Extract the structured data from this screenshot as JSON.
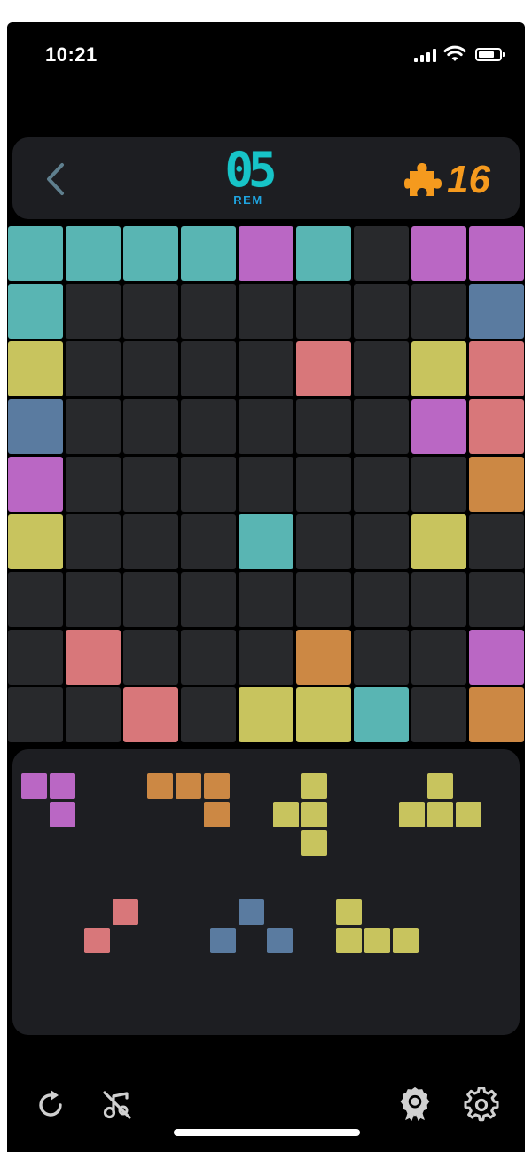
{
  "status_bar": {
    "time": "10:21"
  },
  "header": {
    "remaining_digits": "05",
    "remaining_label": "REM",
    "score": "16"
  },
  "colors": {
    "empty": "#28292c",
    "teal": "#59b5b3",
    "purple": "#ba67c4",
    "blue": "#5a7ba0",
    "yellow": "#c8c45e",
    "salmon": "#d8777a",
    "orange": "#cc8844",
    "accent_rem": "#17c4c8",
    "accent_score": "#f59a1e"
  },
  "icons": {
    "back": "chevron-left-icon",
    "score": "puzzle-piece-icon",
    "restart": "restart-icon",
    "sound": "music-off-icon",
    "achievements": "award-ribbon-icon",
    "settings": "gear-icon"
  },
  "board": {
    "rows": 9,
    "cols": 9,
    "cells": [
      [
        "teal",
        "teal",
        "teal",
        "teal",
        "purple",
        "teal",
        "empty",
        "purple",
        "purple"
      ],
      [
        "teal",
        "empty",
        "empty",
        "empty",
        "empty",
        "empty",
        "empty",
        "empty",
        "blue"
      ],
      [
        "yellow",
        "empty",
        "empty",
        "empty",
        "empty",
        "salmon",
        "empty",
        "yellow",
        "salmon"
      ],
      [
        "blue",
        "empty",
        "empty",
        "empty",
        "empty",
        "empty",
        "empty",
        "purple",
        "salmon"
      ],
      [
        "purple",
        "empty",
        "empty",
        "empty",
        "empty",
        "empty",
        "empty",
        "empty",
        "orange"
      ],
      [
        "yellow",
        "empty",
        "empty",
        "empty",
        "teal",
        "empty",
        "empty",
        "yellow",
        "empty"
      ],
      [
        "empty",
        "empty",
        "empty",
        "empty",
        "empty",
        "empty",
        "empty",
        "empty",
        "empty"
      ],
      [
        "empty",
        "salmon",
        "empty",
        "empty",
        "empty",
        "orange",
        "empty",
        "empty",
        "purple"
      ],
      [
        "empty",
        "empty",
        "salmon",
        "empty",
        "yellow",
        "yellow",
        "teal",
        "empty",
        "orange"
      ]
    ]
  },
  "tray": {
    "pieces": [
      {
        "color": "purple",
        "cells": [
          [
            0,
            0
          ],
          [
            1,
            0
          ],
          [
            1,
            1
          ]
        ]
      },
      {
        "color": "orange",
        "cells": [
          [
            0,
            0
          ],
          [
            1,
            0
          ],
          [
            2,
            0
          ],
          [
            2,
            1
          ]
        ]
      },
      {
        "color": "yellow",
        "cells": [
          [
            1,
            0
          ],
          [
            0,
            1
          ],
          [
            1,
            1
          ],
          [
            1,
            2
          ]
        ]
      },
      {
        "color": "yellow",
        "cells": [
          [
            1,
            0
          ],
          [
            0,
            1
          ],
          [
            1,
            1
          ],
          [
            2,
            1
          ]
        ]
      },
      {
        "color": "salmon",
        "cells": [
          [
            1,
            0
          ],
          [
            0,
            1
          ]
        ]
      },
      {
        "color": "blue",
        "cells": [
          [
            1,
            0
          ],
          [
            0,
            1
          ],
          [
            2,
            1
          ]
        ]
      },
      {
        "color": "yellow",
        "cells": [
          [
            0,
            0
          ],
          [
            0,
            1
          ],
          [
            1,
            1
          ],
          [
            2,
            1
          ]
        ]
      }
    ]
  }
}
